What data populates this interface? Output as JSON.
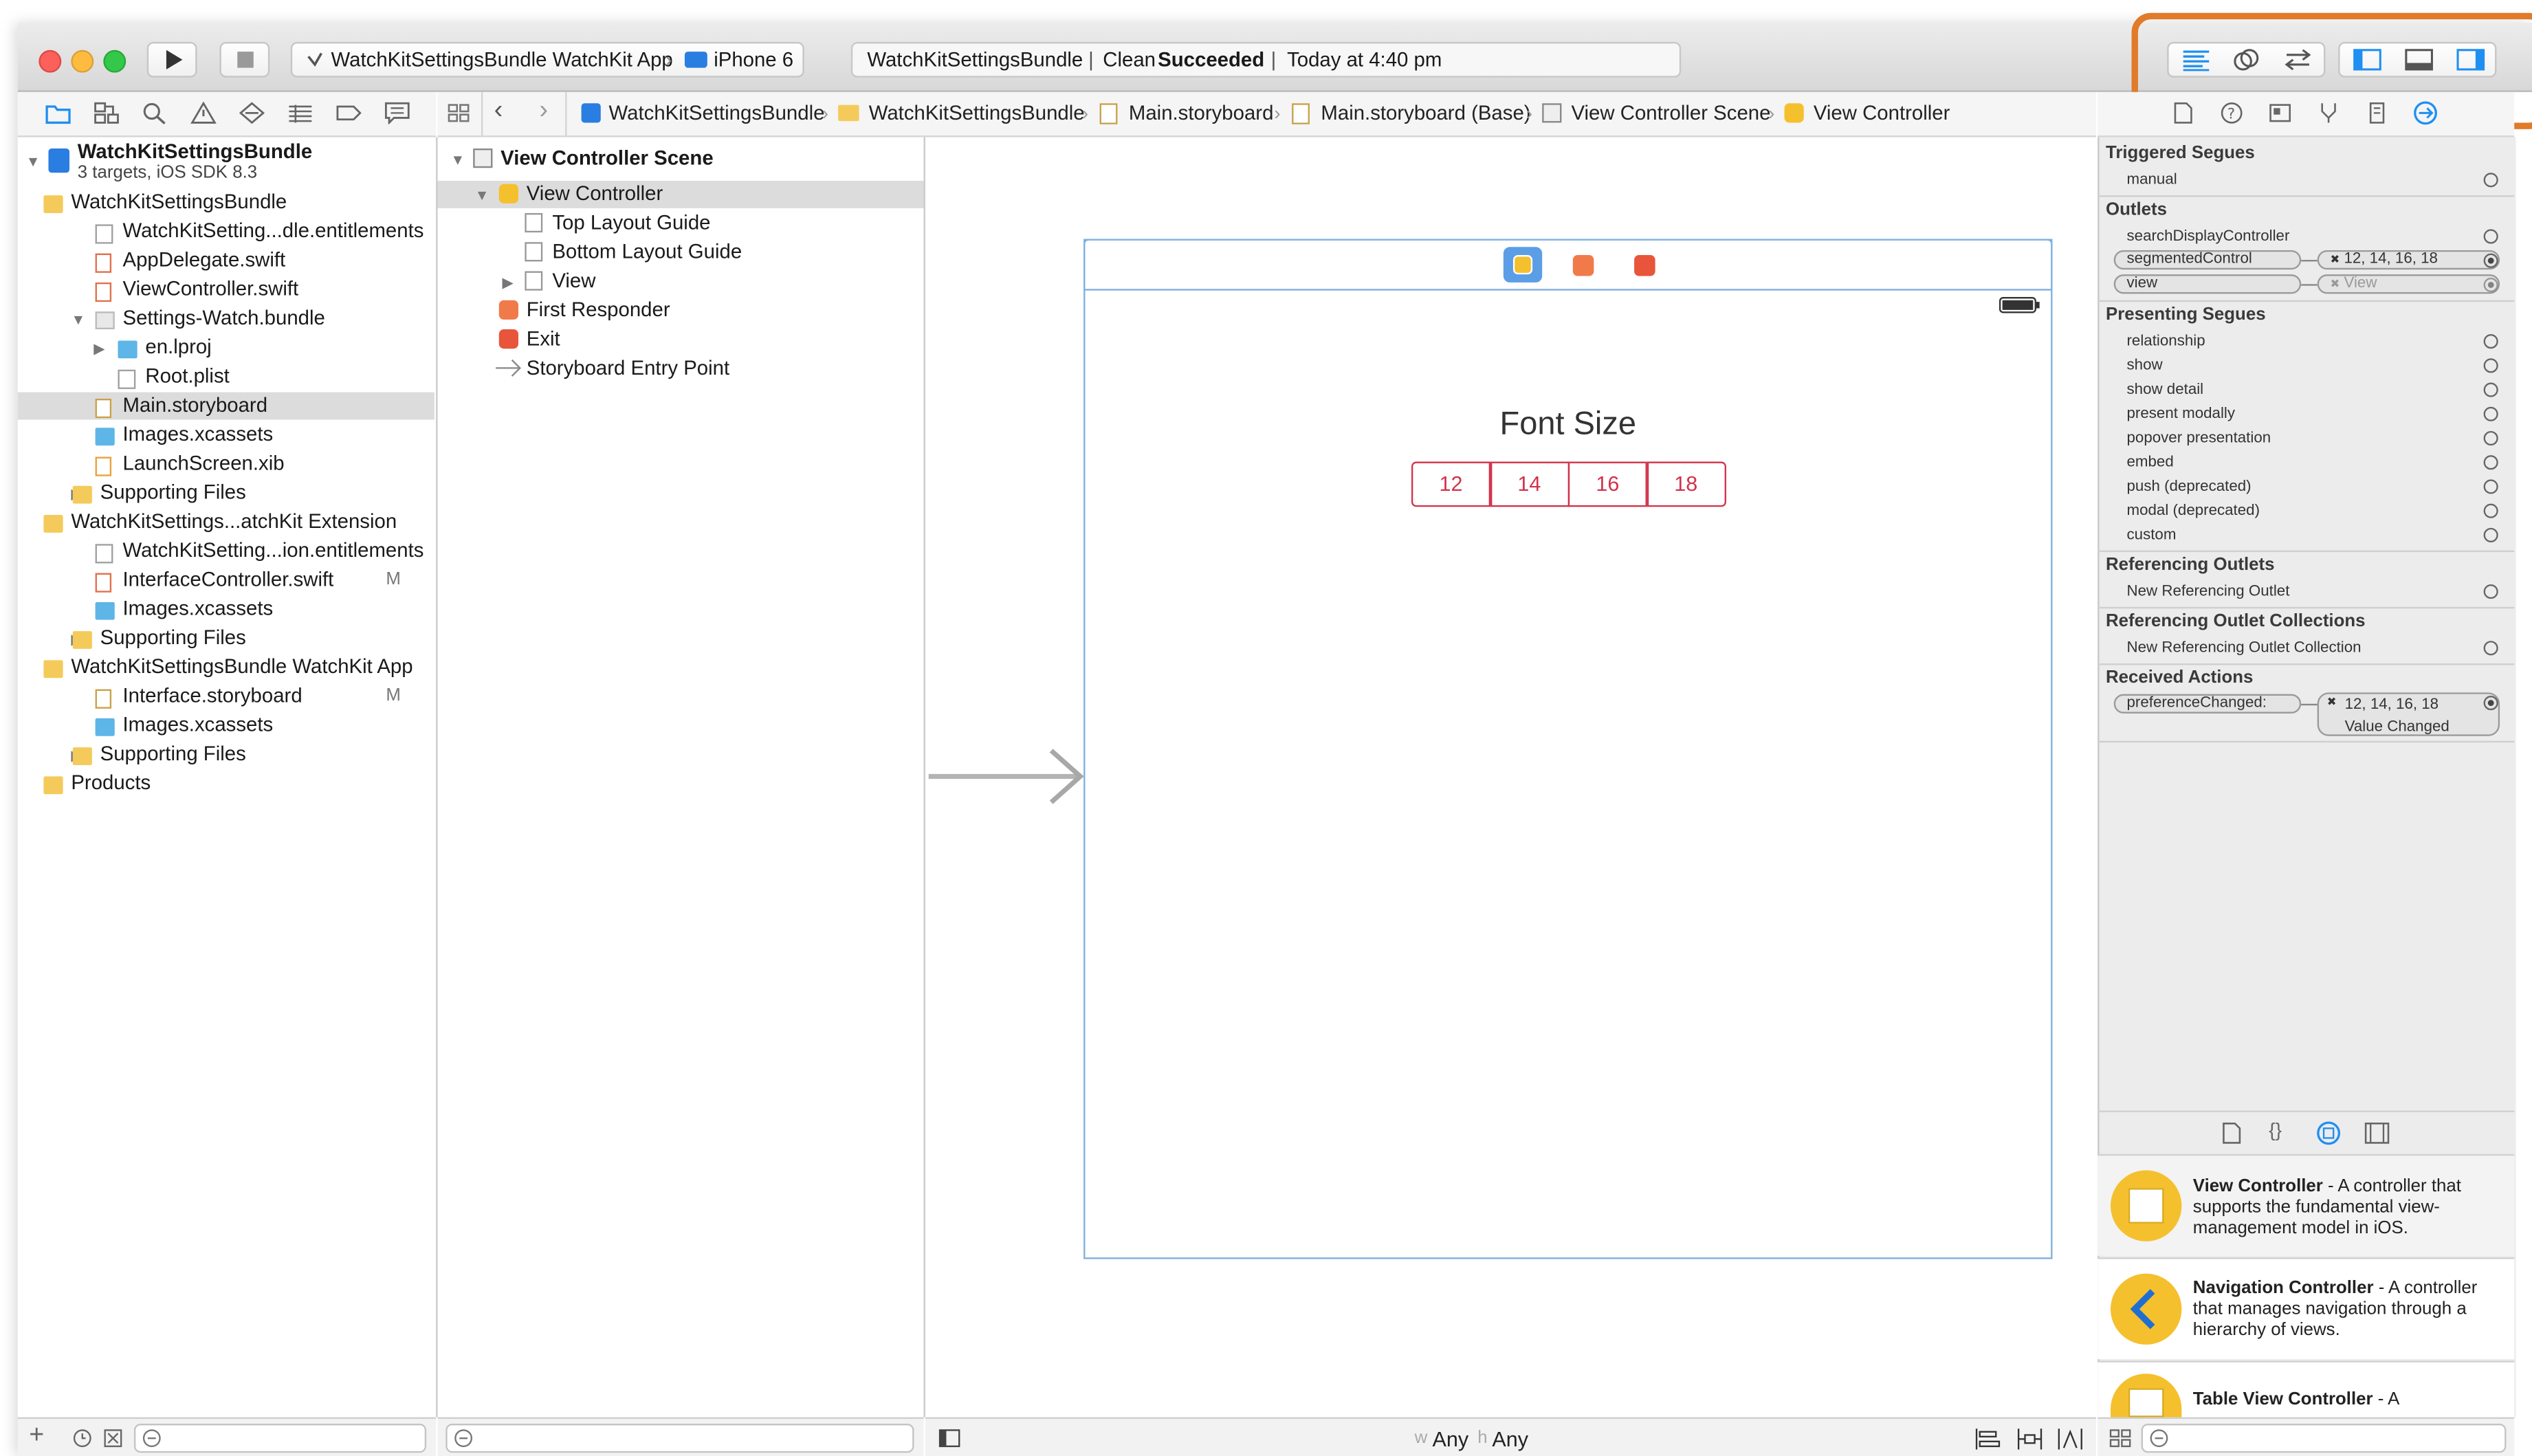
{
  "toolbar": {
    "scheme_target": "WatchKitSettingsBundle WatchKit App",
    "scheme_device": "iPhone 6",
    "activity_project": "WatchKitSettingsBundle",
    "activity_action": "Clean",
    "activity_status": "Succeeded",
    "activity_time": "Today at 4:40 pm"
  },
  "jump_bar": [
    "WatchKitSettingsBundle",
    "WatchKitSettingsBundle",
    "Main.storyboard",
    "Main.storyboard (Base)",
    "View Controller Scene",
    "View Controller"
  ],
  "navigator": {
    "project_name": "WatchKitSettingsBundle",
    "project_subtitle": "3 targets, iOS SDK 8.3",
    "items": [
      {
        "label": "WatchKitSettingsBundle",
        "type": "folder"
      },
      {
        "label": "WatchKitSetting...dle.entitlements",
        "type": "doc"
      },
      {
        "label": "AppDelegate.swift",
        "type": "swift"
      },
      {
        "label": "ViewController.swift",
        "type": "swift"
      },
      {
        "label": "Settings-Watch.bundle",
        "type": "bundle"
      },
      {
        "label": "en.lproj",
        "type": "bluefolder"
      },
      {
        "label": "Root.plist",
        "type": "doc"
      },
      {
        "label": "Main.storyboard",
        "type": "storyboard"
      },
      {
        "label": "Images.xcassets",
        "type": "bluefolder"
      },
      {
        "label": "LaunchScreen.xib",
        "type": "xib"
      },
      {
        "label": "Supporting Files",
        "type": "folder"
      },
      {
        "label": "WatchKitSettings...atchKit Extension",
        "type": "folder"
      },
      {
        "label": "WatchKitSetting...ion.entitlements",
        "type": "doc"
      },
      {
        "label": "InterfaceController.swift",
        "type": "swift",
        "badge": "M"
      },
      {
        "label": "Images.xcassets",
        "type": "bluefolder"
      },
      {
        "label": "Supporting Files",
        "type": "folder"
      },
      {
        "label": "WatchKitSettingsBundle WatchKit App",
        "type": "folder"
      },
      {
        "label": "Interface.storyboard",
        "type": "storyboard",
        "badge": "M"
      },
      {
        "label": "Images.xcassets",
        "type": "bluefolder"
      },
      {
        "label": "Supporting Files",
        "type": "folder"
      },
      {
        "label": "Products",
        "type": "folder"
      }
    ]
  },
  "outline": {
    "scene": "View Controller Scene",
    "items": [
      "View Controller",
      "Top Layout Guide",
      "Bottom Layout Guide",
      "View",
      "First Responder",
      "Exit",
      "Storyboard Entry Point"
    ]
  },
  "canvas": {
    "label_text": "Font Size",
    "segments": [
      "12",
      "14",
      "16",
      "18"
    ],
    "size_class_w": "Any",
    "size_class_h": "Any",
    "w_prefix": "w",
    "h_prefix": "h"
  },
  "inspector": {
    "triggered_segues": "Triggered Segues",
    "manual": "manual",
    "outlets": "Outlets",
    "outlet_search": "searchDisplayController",
    "outlet_segmented": "segmentedControl",
    "outlet_segmented_value": "12, 14, 16, 18",
    "outlet_view": "view",
    "outlet_view_value": "View",
    "presenting_segues": "Presenting Segues",
    "segues": [
      "relationship",
      "show",
      "show detail",
      "present modally",
      "popover presentation",
      "embed",
      "push (deprecated)",
      "modal (deprecated)",
      "custom"
    ],
    "referencing_outlets": "Referencing Outlets",
    "new_ref_outlet": "New Referencing Outlet",
    "referencing_collections": "Referencing Outlet Collections",
    "new_ref_collection": "New Referencing Outlet Collection",
    "received_actions": "Received Actions",
    "action_name": "preferenceChanged:",
    "action_target": "12, 14, 16, 18",
    "action_event": "Value Changed",
    "close_glyph": "✖"
  },
  "library": [
    {
      "title": "View Controller",
      "desc": " - A controller that supports the fundamental view-management model in iOS."
    },
    {
      "title": "Navigation Controller",
      "desc": " - A controller that manages navigation through a hierarchy of views."
    },
    {
      "title": "Table View Controller",
      "desc": " - A"
    }
  ],
  "colors": {
    "accent_blue": "#1f8ff2",
    "segment_red": "#d2334b",
    "highlight_orange": "#e07b2a",
    "folder_yellow": "#f4cb5a"
  }
}
